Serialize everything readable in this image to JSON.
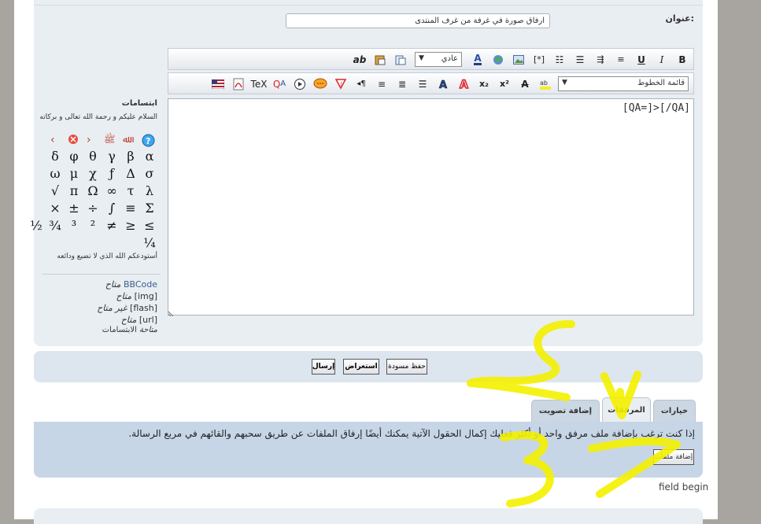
{
  "form": {
    "title_label": "عنوان:",
    "title_value": "ارفاق صورة في غرفة من غرف المنتدى"
  },
  "toolbar": {
    "row1_size": "عادي",
    "row2_font": "قائمة الخطوط",
    "buttons_row1": [
      "bold-button",
      "italic-button",
      "underline-button",
      "list-button",
      "indent-button",
      "bullets-button",
      "numbered-list-button",
      "list-item-button",
      "image-button",
      "link-button",
      "font-color-button",
      "size-select",
      "paste-button",
      "clipboard-button",
      "spellcheck-button"
    ],
    "tex_label": "TeX",
    "qa_label": "QA"
  },
  "editor": {
    "content": "[QA=]>[/QA]"
  },
  "smilies": {
    "title": "ابتسامات",
    "salam": "السلام عليكم و رحمة الله تعالى و بركاته",
    "farewell": "أستودعكم الله الذي لا تضيع ودائعه",
    "symbols": [
      [
        "α",
        "β",
        "γ",
        "θ",
        "φ",
        "δ"
      ],
      [
        "σ",
        "Δ",
        "ƒ",
        "χ",
        "μ",
        "ω"
      ],
      [
        "λ",
        "τ",
        "∞",
        "Ω",
        "π",
        "√"
      ],
      [
        "Σ",
        "≡",
        "∫",
        "÷",
        "±",
        "×"
      ],
      [
        "≤",
        "≥",
        "≠",
        "²",
        "³",
        "¾",
        "½"
      ],
      [
        "¼"
      ]
    ]
  },
  "status": {
    "bbcode_key": "BBCode",
    "bbcode_val": "متاح",
    "img_key": "[img]",
    "img_val": "متاح",
    "flash_key": "[flash]",
    "flash_val": "غير متاح",
    "url_key": "[url]",
    "url_val": "متاح",
    "smilies_key": "الابتسامات",
    "smilies_val": "متاحة"
  },
  "buttons": {
    "send": "إرسال",
    "preview": "استعراض",
    "save_draft": "حفظ مسودة"
  },
  "tabs": {
    "options": "خيارات",
    "attachments": "المرفقات",
    "poll": "إضافة تصويت"
  },
  "attachments": {
    "info": "إذا كنت ترغب بإضافة ملف مرفق واحد أو أكثر فعليك إكمال الحقول الآتية يمكنك أيضًا إرفاق الملفات عن طريق سحبهم والقائهم في مربع الرسالة.",
    "add_button": "إضافة ملفات"
  },
  "footer": {
    "field_begin": "field begin"
  },
  "colors": {
    "annotation": "#f4f100",
    "panel": "#e9eef3",
    "tabpanel": "#c7d6e6"
  }
}
